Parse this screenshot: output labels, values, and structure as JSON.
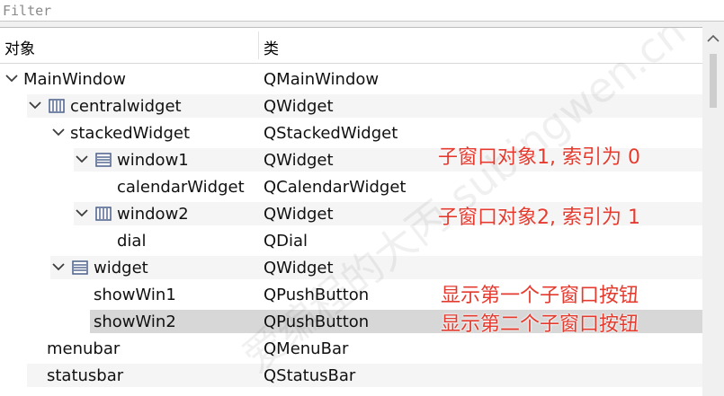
{
  "filter": {
    "placeholder": "Filter"
  },
  "header": {
    "object": "对象",
    "class": "类"
  },
  "rows": [
    {
      "name": "MainWindow",
      "class": "QMainWindow",
      "arrow": "expanded",
      "icon": ""
    },
    {
      "name": "centralwidget",
      "class": "QWidget",
      "arrow": "expanded",
      "icon": "layout-columns-icon"
    },
    {
      "name": "stackedWidget",
      "class": "QStackedWidget",
      "arrow": "expanded",
      "icon": ""
    },
    {
      "name": "window1",
      "class": "QWidget",
      "arrow": "expanded",
      "icon": "layout-rows-icon"
    },
    {
      "name": "calendarWidget",
      "class": "QCalendarWidget",
      "arrow": "",
      "icon": ""
    },
    {
      "name": "window2",
      "class": "QWidget",
      "arrow": "expanded",
      "icon": "layout-columns-icon"
    },
    {
      "name": "dial",
      "class": "QDial",
      "arrow": "",
      "icon": ""
    },
    {
      "name": "widget",
      "class": "QWidget",
      "arrow": "expanded",
      "icon": "layout-rows-icon"
    },
    {
      "name": "showWin1",
      "class": "QPushButton",
      "arrow": "",
      "icon": ""
    },
    {
      "name": "showWin2",
      "class": "QPushButton",
      "arrow": "",
      "icon": "",
      "selected": true
    },
    {
      "name": "menubar",
      "class": "QMenuBar",
      "arrow": "",
      "icon": ""
    },
    {
      "name": "statusbar",
      "class": "QStatusBar",
      "arrow": "",
      "icon": ""
    }
  ],
  "annotations": {
    "note1": "子窗口对象1, 索引为 0",
    "note2": "子窗口对象2, 索引为 1",
    "note3": "显示第一个子窗口按钮",
    "note4": "显示第二个子窗口按钮"
  },
  "watermark": "爱编程的大丙 subingwen.cn",
  "colors": {
    "annotation": "#e53b2f",
    "selected_row": "#d7d7d7",
    "alt_row": "#f5f5f5"
  }
}
